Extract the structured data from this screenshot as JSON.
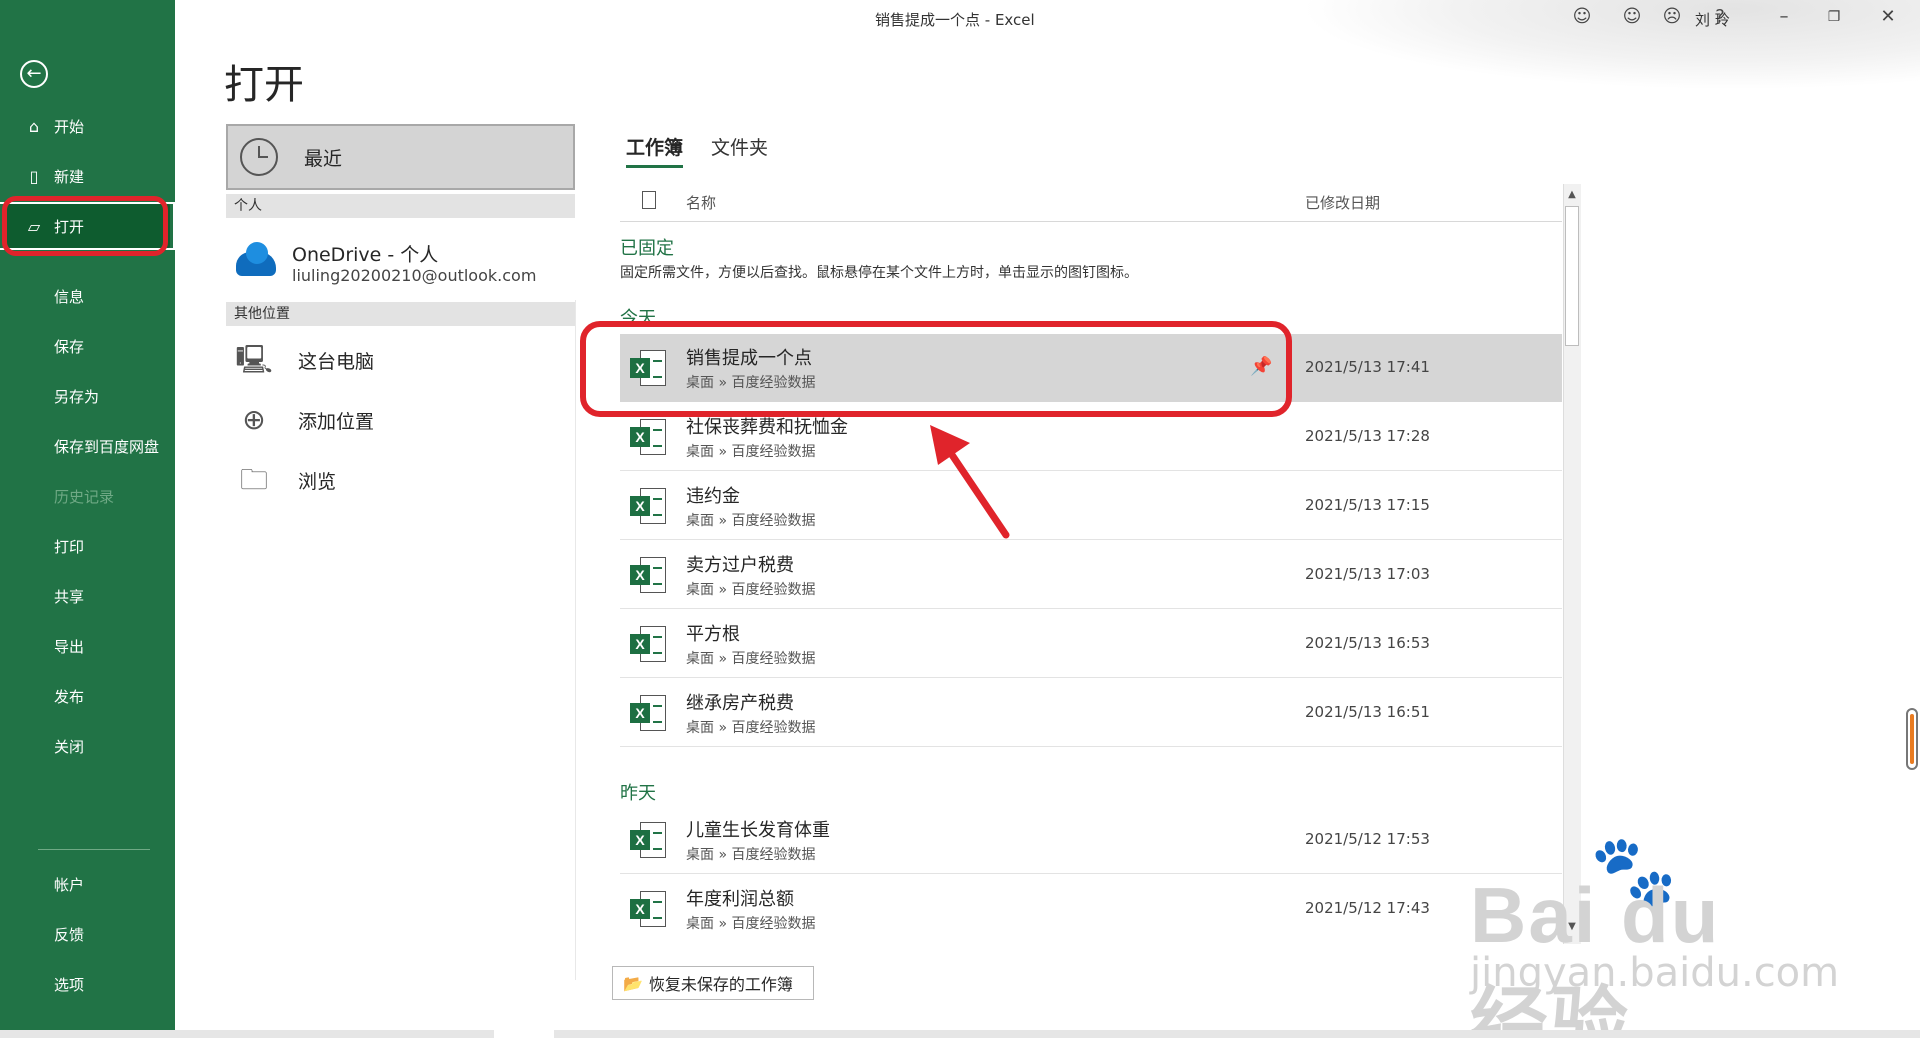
{
  "window": {
    "title": "销售提成一个点 - Excel",
    "user_name": "刘 玲"
  },
  "nav": {
    "items": [
      {
        "label": "开始",
        "icon": "home-icon",
        "glyph": "⌂"
      },
      {
        "label": "新建",
        "icon": "new-file-icon",
        "glyph": "🗋"
      },
      {
        "label": "打开",
        "icon": "folder-open-icon",
        "glyph": "🗁"
      },
      {
        "label": "信息"
      },
      {
        "label": "保存"
      },
      {
        "label": "另存为"
      },
      {
        "label": "保存到百度网盘"
      },
      {
        "label": "历史记录"
      },
      {
        "label": "打印"
      },
      {
        "label": "共享"
      },
      {
        "label": "导出"
      },
      {
        "label": "发布"
      },
      {
        "label": "关闭"
      },
      {
        "label": "帐户"
      },
      {
        "label": "反馈"
      },
      {
        "label": "选项"
      }
    ],
    "active": "打开",
    "disabled": "历史记录"
  },
  "page": {
    "heading": "打开"
  },
  "locations": {
    "recent_label": "最近",
    "personal_header": "个人",
    "onedrive_title": "OneDrive - 个人",
    "onedrive_email": "liuling20200210@outlook.com",
    "other_header": "其他位置",
    "this_pc": "这台电脑",
    "add_place": "添加位置",
    "browse": "浏览"
  },
  "tabs": {
    "workbooks": "工作簿",
    "folders": "文件夹"
  },
  "list": {
    "col_name": "名称",
    "col_date": "已修改日期",
    "pinned_title": "已固定",
    "pinned_desc": "固定所需文件，方便以后查找。鼠标悬停在某个文件上方时，单击显示的图钉图标。",
    "today_title": "今天",
    "yesterday_title": "昨天",
    "today_files": [
      {
        "name": "销售提成一个点",
        "path": "桌面 » 百度经验数据",
        "date": "2021/5/13 17:41"
      },
      {
        "name": "社保丧葬费和抚恤金",
        "path": "桌面 » 百度经验数据",
        "date": "2021/5/13 17:28"
      },
      {
        "name": "违约金",
        "path": "桌面 » 百度经验数据",
        "date": "2021/5/13 17:15"
      },
      {
        "name": "卖方过户税费",
        "path": "桌面 » 百度经验数据",
        "date": "2021/5/13 17:03"
      },
      {
        "name": "平方根",
        "path": "桌面 » 百度经验数据",
        "date": "2021/5/13 16:53"
      },
      {
        "name": "继承房产税费",
        "path": "桌面 » 百度经验数据",
        "date": "2021/5/13 16:51"
      }
    ],
    "yesterday_files": [
      {
        "name": "儿童生长发育体重",
        "path": "桌面 » 百度经验数据",
        "date": "2021/5/12 17:53"
      },
      {
        "name": "年度利润总额",
        "path": "桌面 » 百度经验数据",
        "date": "2021/5/12 17:43"
      }
    ]
  },
  "recover_button": "恢复未保存的工作簿",
  "watermark": {
    "brand": "Bai du 经验",
    "url": "jingyan.baidu.com"
  },
  "colors": {
    "excel_green": "#217346",
    "annotation_red": "#e0242b"
  }
}
